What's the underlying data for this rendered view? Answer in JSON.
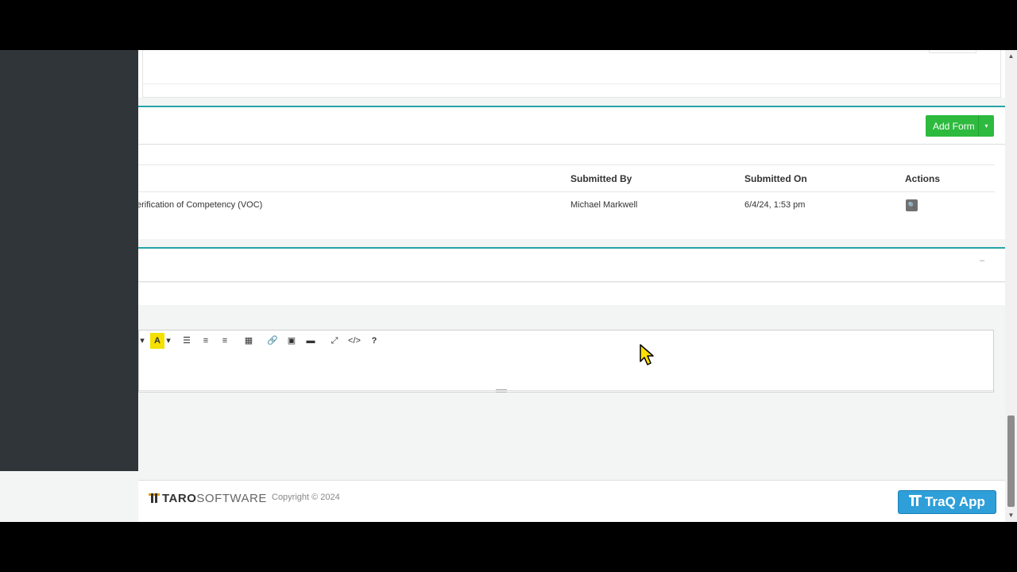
{
  "forms": {
    "add_form_label": "Add Form",
    "add_form_caret": "▾",
    "columns": [
      "Submitted By",
      "Submitted On",
      "Actions"
    ],
    "rows": [
      {
        "form_name": "erification of Competency (VOC)",
        "submitted_by": "Michael Markwell",
        "submitted_on": "6/4/24, 1:53 pm",
        "view_icon": "🔍"
      }
    ]
  },
  "notes": {
    "collapse_glyph": "–",
    "toolbar": {
      "dropdown_caret": "▾",
      "highlight": "A",
      "ul": "☰",
      "ol": "≡",
      "align": "≡",
      "table": "▦",
      "link": "🔗",
      "image": "▣",
      "video": "▬",
      "fullscreen": "⤢",
      "code": "</>",
      "help": "?"
    }
  },
  "footer": {
    "logo_bold": "TARO",
    "logo_light": "SOFTWARE",
    "copyright": "Copyright © 2024",
    "app_button": "TraQ App"
  },
  "scrollbar": {
    "up_arrow": "▲",
    "down_arrow": "▼"
  },
  "colors": {
    "accent_teal": "#26a4a8",
    "add_green": "#2dba3e",
    "traq_blue": "#2e9fd8",
    "sidebar": "#2f3538"
  }
}
